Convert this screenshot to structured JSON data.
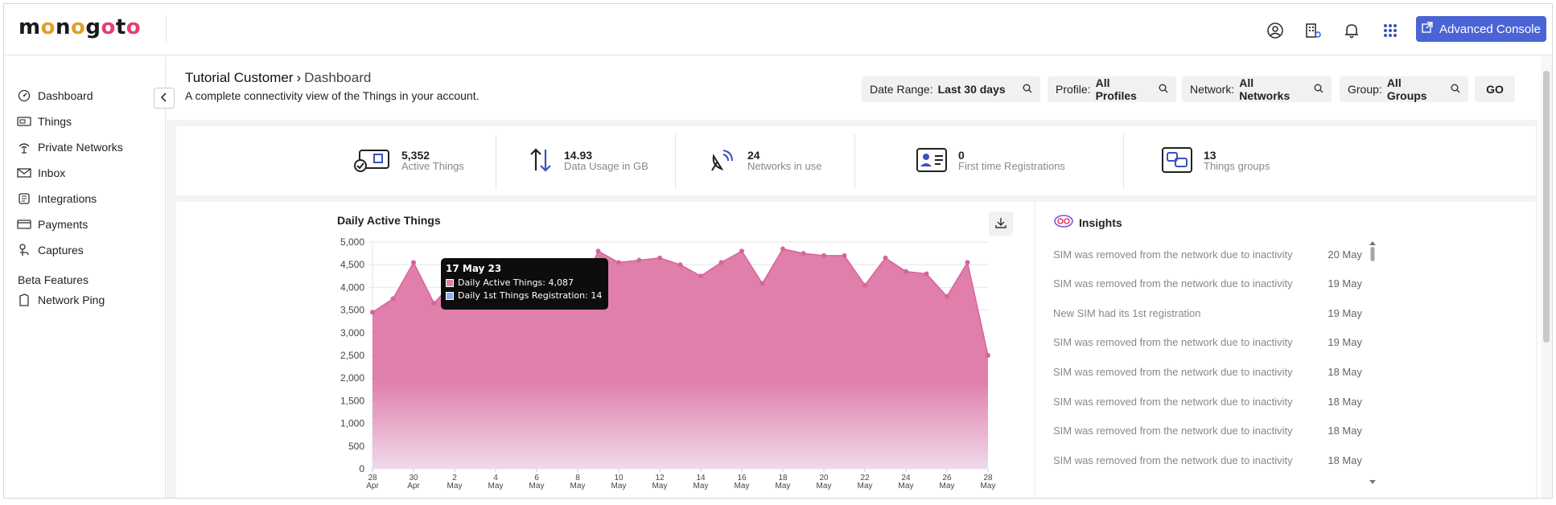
{
  "brand": {
    "logo_text_a": "m",
    "logo_text_b": "o",
    "logo_text_c": "n",
    "logo_text_d": "o",
    "logo_text_e": "g",
    "logo_text_f": "o",
    "logo_text_g": "t",
    "logo_text_h": "o"
  },
  "topbar": {
    "icons": [
      "user-circle-icon",
      "building-icon",
      "bell-icon",
      "apps-grid-icon"
    ],
    "advanced_console_label": "Advanced Console",
    "accent": "#4a64d6"
  },
  "sidebar": {
    "items": [
      {
        "label": "Dashboard",
        "icon": "dashboard-icon"
      },
      {
        "label": "Things",
        "icon": "sim-card-icon"
      },
      {
        "label": "Private Networks",
        "icon": "antenna-icon"
      },
      {
        "label": "Inbox",
        "icon": "envelope-icon"
      },
      {
        "label": "Integrations",
        "icon": "integrations-icon"
      },
      {
        "label": "Payments",
        "icon": "credit-card-icon"
      },
      {
        "label": "Captures",
        "icon": "capture-icon"
      }
    ],
    "beta_label": "Beta Features",
    "beta_items": [
      {
        "label": "Network Ping",
        "icon": "ping-icon"
      }
    ]
  },
  "header": {
    "customer": "Tutorial Customer",
    "separator": "›",
    "page": "Dashboard",
    "subtitle": "A complete connectivity view of the Things in your account."
  },
  "filters": {
    "date_range": {
      "label": "Date Range:",
      "value": "Last 30 days"
    },
    "profile": {
      "label": "Profile:",
      "value": "All Profiles"
    },
    "network": {
      "label": "Network:",
      "value": "All Networks"
    },
    "group": {
      "label": "Group:",
      "value": "All Groups"
    },
    "go_label": "GO"
  },
  "stats": [
    {
      "value": "5,352",
      "label": "Active Things",
      "icon": "active-things-icon"
    },
    {
      "value": "14.93",
      "label": "Data Usage in GB",
      "icon": "arrows-updown-icon"
    },
    {
      "value": "24",
      "label": "Networks in use",
      "icon": "satellite-dish-icon"
    },
    {
      "value": "0",
      "label": "First time Registrations",
      "icon": "id-card-icon"
    },
    {
      "value": "13",
      "label": "Things groups",
      "icon": "groups-icon"
    }
  ],
  "chart_panel": {
    "title": "Daily Active Things",
    "download_icon": "download-icon"
  },
  "tooltip": {
    "date": "17 May 23",
    "rows": [
      {
        "label": "Daily Active Things: 4,087",
        "color": "#e07fab"
      },
      {
        "label": "Daily 1st Things Registration: 14",
        "color": "#8fb0e8"
      }
    ]
  },
  "chart_data": {
    "type": "area",
    "title": "Daily Active Things",
    "ylim": [
      0,
      5000
    ],
    "yticks": [
      "5,000",
      "4,500",
      "4,000",
      "3,500",
      "3,000",
      "2,500",
      "2,000",
      "1,500",
      "1,000",
      "500",
      "0"
    ],
    "xtick_labels": [
      [
        "28",
        "Apr"
      ],
      [
        "30",
        "Apr"
      ],
      [
        "2",
        "May"
      ],
      [
        "4",
        "May"
      ],
      [
        "6",
        "May"
      ],
      [
        "8",
        "May"
      ],
      [
        "10",
        "May"
      ],
      [
        "12",
        "May"
      ],
      [
        "14",
        "May"
      ],
      [
        "16",
        "May"
      ],
      [
        "18",
        "May"
      ],
      [
        "20",
        "May"
      ],
      [
        "22",
        "May"
      ],
      [
        "24",
        "May"
      ],
      [
        "26",
        "May"
      ],
      [
        "28",
        "May"
      ]
    ],
    "x": [
      "28 Apr",
      "29 Apr",
      "30 Apr",
      "1 May",
      "2 May",
      "3 May",
      "4 May",
      "5 May",
      "6 May",
      "7 May",
      "8 May",
      "9 May",
      "10 May",
      "11 May",
      "12 May",
      "13 May",
      "14 May",
      "15 May",
      "16 May",
      "17 May",
      "18 May",
      "19 May",
      "20 May",
      "21 May",
      "22 May",
      "23 May",
      "24 May",
      "25 May",
      "26 May",
      "27 May",
      "28 May"
    ],
    "series": [
      {
        "name": "Daily Active Things",
        "color": "#e07fab",
        "values": [
          3450,
          3750,
          4550,
          3650,
          4150,
          4400,
          4150,
          4350,
          4550,
          3650,
          3750,
          4800,
          4550,
          4600,
          4650,
          4500,
          4250,
          4550,
          4800,
          4087,
          4850,
          4750,
          4700,
          4700,
          4050,
          4650,
          4350,
          4300,
          3800,
          4550,
          2500
        ]
      },
      {
        "name": "Daily 1st Things Registration",
        "color": "#8fb0e8",
        "values": [
          null,
          null,
          null,
          null,
          null,
          null,
          null,
          null,
          null,
          null,
          null,
          null,
          null,
          null,
          null,
          null,
          null,
          null,
          null,
          14,
          null,
          null,
          null,
          null,
          null,
          null,
          null,
          null,
          null,
          null,
          null
        ]
      }
    ],
    "grid": true
  },
  "insights": {
    "title": "Insights",
    "icon": "insights-icon",
    "items": [
      {
        "message": "SIM was removed from the network due to inactivity",
        "date": "20 May"
      },
      {
        "message": "SIM was removed from the network due to inactivity",
        "date": "19 May"
      },
      {
        "message": "New SIM had its 1st registration",
        "date": "19 May"
      },
      {
        "message": "SIM was removed from the network due to inactivity",
        "date": "19 May"
      },
      {
        "message": "SIM was removed from the network due to inactivity",
        "date": "18 May"
      },
      {
        "message": "SIM was removed from the network due to inactivity",
        "date": "18 May"
      },
      {
        "message": "SIM was removed from the network due to inactivity",
        "date": "18 May"
      },
      {
        "message": "SIM was removed from the network due to inactivity",
        "date": "18 May"
      }
    ]
  }
}
